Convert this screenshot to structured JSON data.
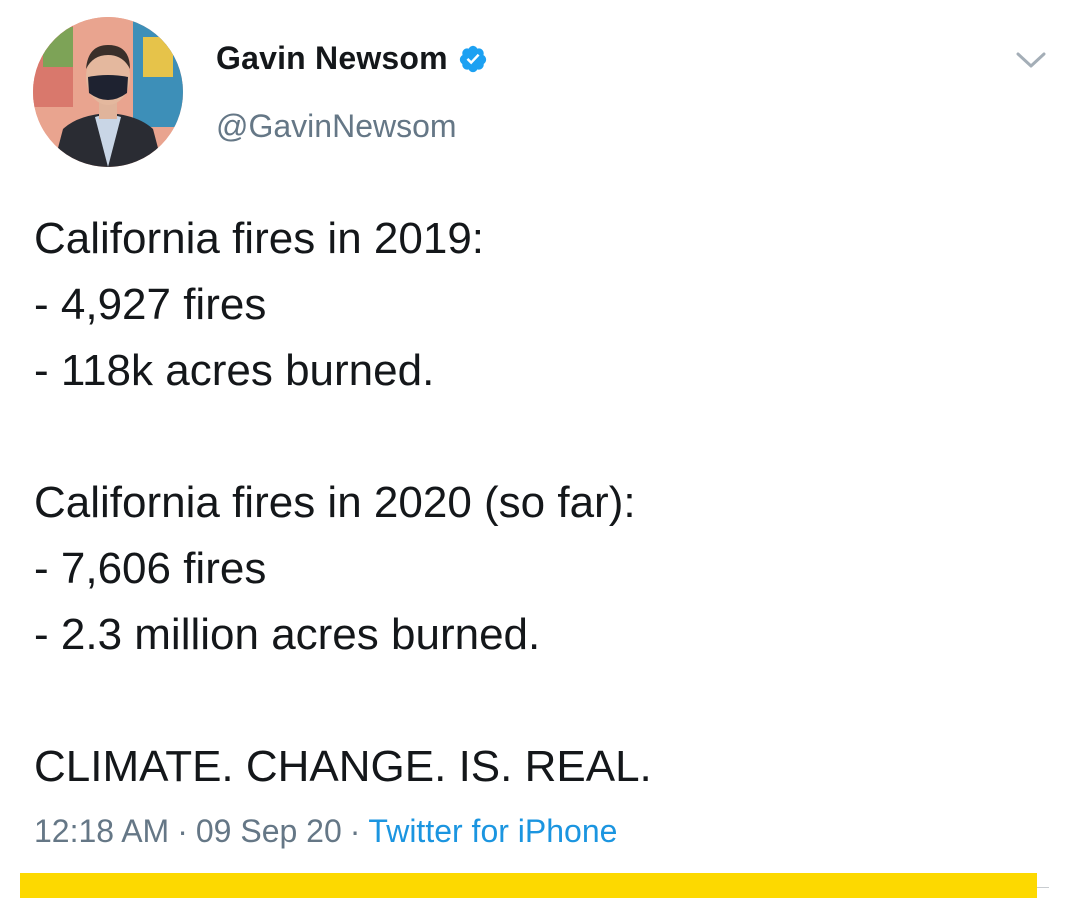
{
  "tweet": {
    "author": {
      "display_name": "Gavin Newsom",
      "handle": "@GavinNewsom",
      "verified": true,
      "avatar_icon": "profile-photo"
    },
    "more_icon": "chevron-down-icon",
    "lines": [
      "California fires in 2019:",
      "- 4,927 fires",
      "- 118k acres burned.",
      "",
      "California fires in 2020 (so far):",
      "- 7,606 fires",
      "- 2.3 million acres burned.",
      "",
      "CLIMATE. CHANGE. IS. REAL."
    ],
    "meta": {
      "time": "12:18 AM",
      "separator": "·",
      "date": "09 Sep 20",
      "source": "Twitter for iPhone"
    }
  },
  "colors": {
    "verified_blue": "#1da1f2",
    "link_blue": "#1b95e0",
    "secondary_text": "#657786",
    "highlight_yellow": "#fdd900"
  }
}
